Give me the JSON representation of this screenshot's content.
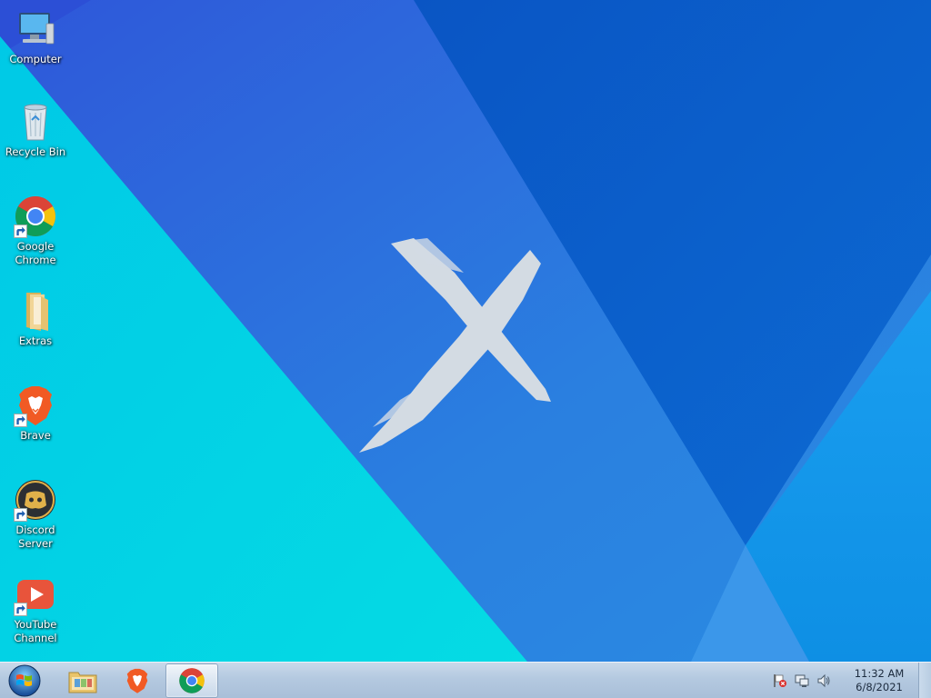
{
  "desktop": {
    "icons": [
      {
        "label": "Computer",
        "icon": "computer-icon",
        "shortcut": false
      },
      {
        "label": "Recycle Bin",
        "icon": "recycle-bin-icon",
        "shortcut": false
      },
      {
        "label": "Google Chrome",
        "icon": "chrome-icon",
        "shortcut": true
      },
      {
        "label": "Extras",
        "icon": "folder-icon",
        "shortcut": false
      },
      {
        "label": "Brave",
        "icon": "brave-icon",
        "shortcut": true
      },
      {
        "label": "Discord Server",
        "icon": "discord-icon",
        "shortcut": true
      },
      {
        "label": "YouTube Channel",
        "icon": "youtube-icon",
        "shortcut": true
      }
    ]
  },
  "taskbar": {
    "start_icon": "windows-logo-icon",
    "pinned": [
      {
        "icon": "file-explorer-icon",
        "active": false
      },
      {
        "icon": "brave-icon",
        "active": false
      },
      {
        "icon": "chrome-icon",
        "active": true
      }
    ],
    "tray": {
      "icons": [
        "action-center-flag-icon",
        "network-icon",
        "volume-icon"
      ],
      "time": "11:32 AM",
      "date": "6/8/2021"
    }
  },
  "colors": {
    "wallpaper_cyan": "#05d8e6",
    "wallpaper_blue": "#2f6fe0",
    "wallpaper_dark": "#0a5dc8",
    "wallpaper_right": "#0f8fe6",
    "x_mark": "#d0d8e0",
    "taskbar": "#b4c9e0"
  }
}
